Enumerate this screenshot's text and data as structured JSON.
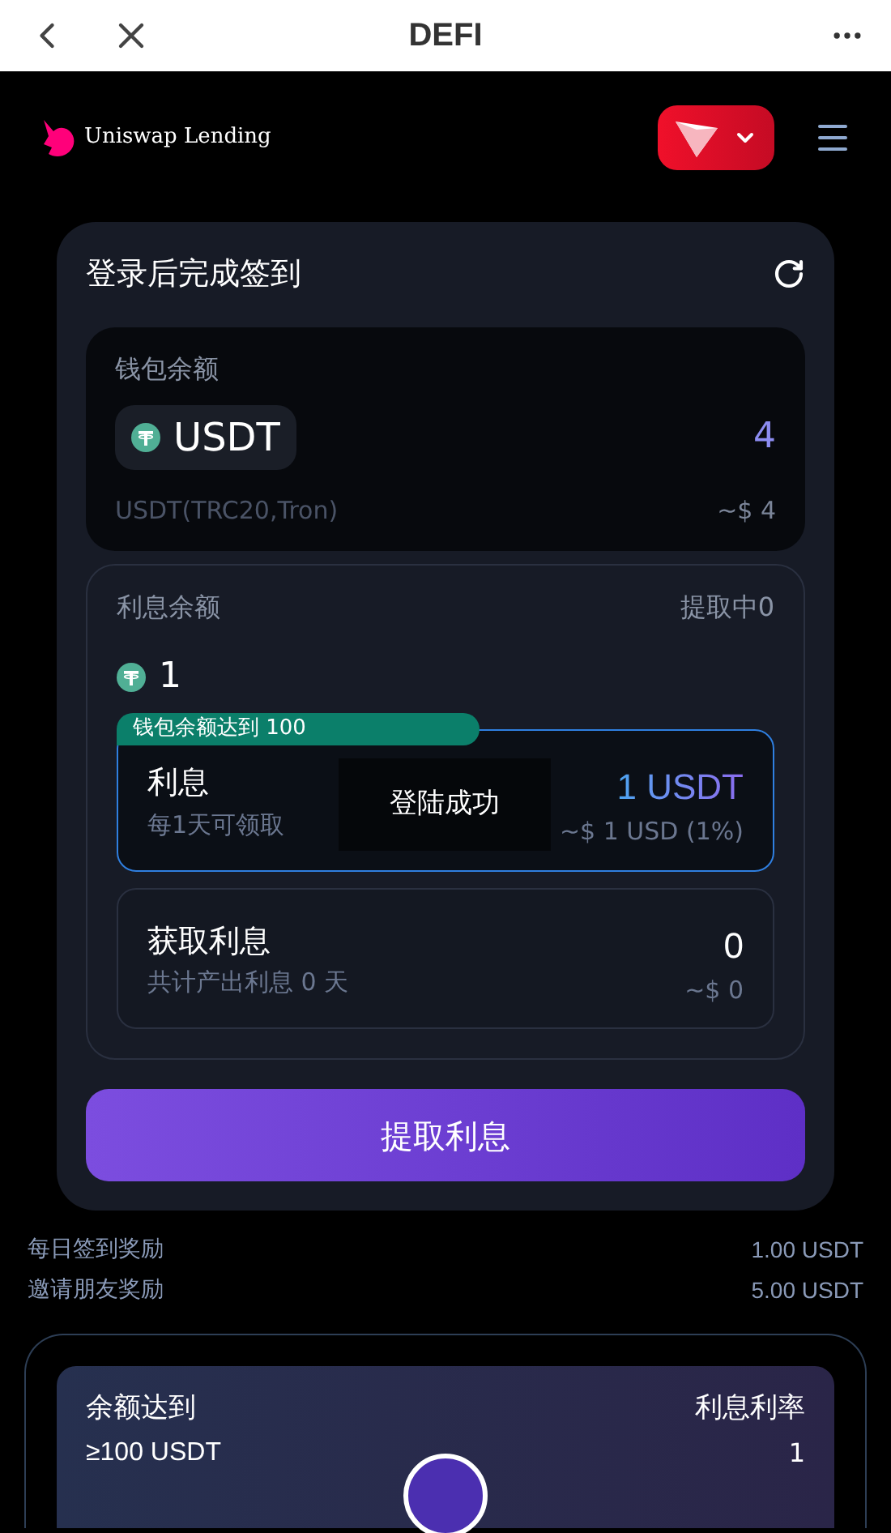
{
  "top_bar": {
    "title": "DEFI"
  },
  "header": {
    "brand": "Uniswap Lending"
  },
  "signin_card": {
    "title": "登录后完成签到",
    "wallet": {
      "label": "钱包余额",
      "token": "USDT",
      "amount": "4",
      "network": "USDT(TRC20,Tron)",
      "usd": "~$ 4"
    },
    "interest": {
      "label": "利息余额",
      "status": "提取中0",
      "amount": "1",
      "badge": "钱包余额达到 100",
      "options": [
        {
          "title": "利息",
          "subtitle": "每1天可领取",
          "value": "1 USDT",
          "usd": "~$ 1 USD (1%)",
          "selected": true
        },
        {
          "title": "获取利息",
          "subtitle": "共计产出利息 0 天",
          "value": "0",
          "usd": "~$ 0",
          "selected": false
        }
      ]
    },
    "button": "提取利息"
  },
  "rewards": [
    {
      "label": "每日签到奖励",
      "value": "1.00 USDT"
    },
    {
      "label": "邀请朋友奖励",
      "value": "5.00 USDT"
    }
  ],
  "tier_card": {
    "left_label": "余额达到",
    "left_value": "≥100 USDT",
    "right_label": "利息利率",
    "right_value": "1"
  },
  "toast": "登陆成功"
}
